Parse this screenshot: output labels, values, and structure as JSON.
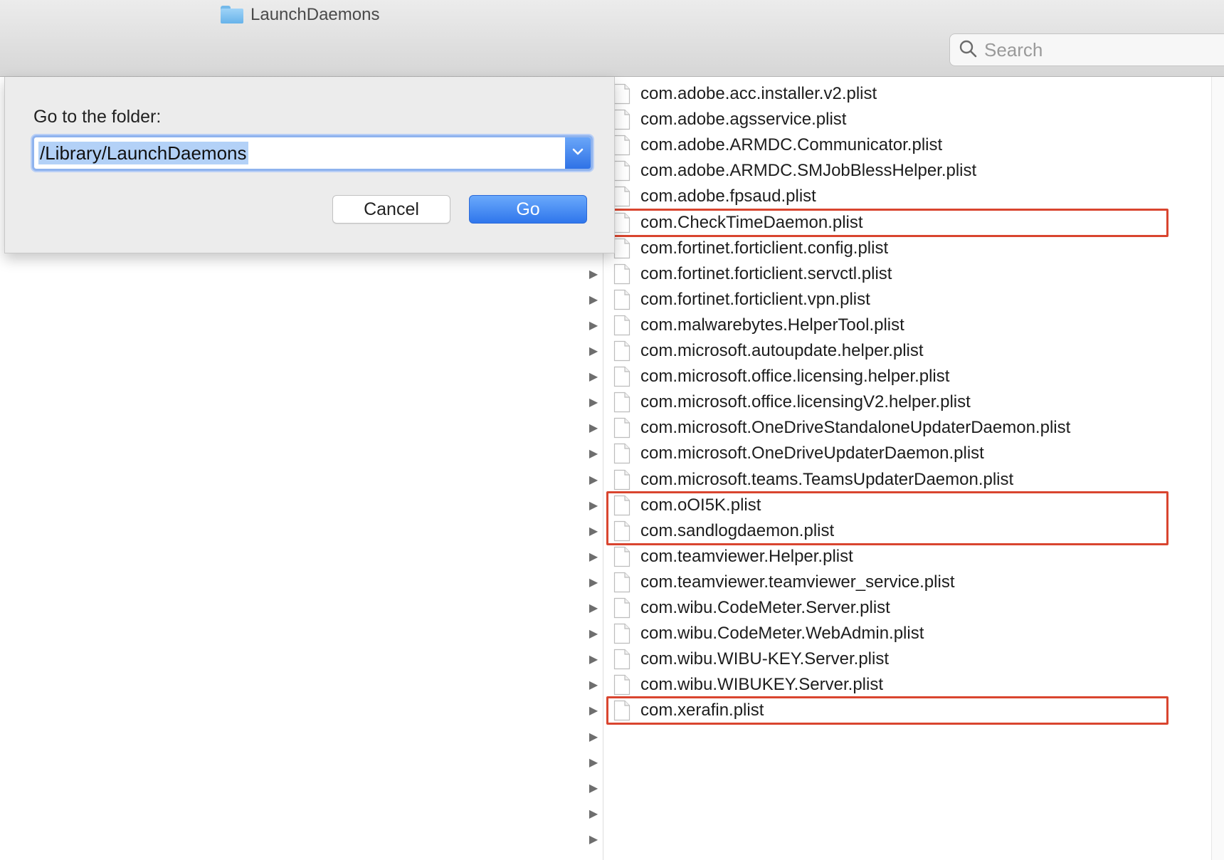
{
  "window": {
    "title": "LaunchDaemons",
    "folder_icon": "folder-icon"
  },
  "search": {
    "placeholder": "Search",
    "icon": "search-icon"
  },
  "goto_dialog": {
    "label": "Go to the folder:",
    "path_value": "/Library/LaunchDaemons",
    "cancel_label": "Cancel",
    "go_label": "Go",
    "accent_color": "#3478f6"
  },
  "files": [
    {
      "name": "com.adobe.acc.installer.v2.plist",
      "highlighted": false
    },
    {
      "name": "com.adobe.agsservice.plist",
      "highlighted": false
    },
    {
      "name": "com.adobe.ARMDC.Communicator.plist",
      "highlighted": false
    },
    {
      "name": "com.adobe.ARMDC.SMJobBlessHelper.plist",
      "highlighted": false
    },
    {
      "name": "com.adobe.fpsaud.plist",
      "highlighted": false
    },
    {
      "name": "com.CheckTimeDaemon.plist",
      "highlighted": true
    },
    {
      "name": "com.fortinet.forticlient.config.plist",
      "highlighted": false
    },
    {
      "name": "com.fortinet.forticlient.servctl.plist",
      "highlighted": false
    },
    {
      "name": "com.fortinet.forticlient.vpn.plist",
      "highlighted": false
    },
    {
      "name": "com.malwarebytes.HelperTool.plist",
      "highlighted": false
    },
    {
      "name": "com.microsoft.autoupdate.helper.plist",
      "highlighted": false
    },
    {
      "name": "com.microsoft.office.licensing.helper.plist",
      "highlighted": false
    },
    {
      "name": "com.microsoft.office.licensingV2.helper.plist",
      "highlighted": false
    },
    {
      "name": "com.microsoft.OneDriveStandaloneUpdaterDaemon.plist",
      "highlighted": false
    },
    {
      "name": "com.microsoft.OneDriveUpdaterDaemon.plist",
      "highlighted": false
    },
    {
      "name": "com.microsoft.teams.TeamsUpdaterDaemon.plist",
      "highlighted": false
    },
    {
      "name": "com.oOI5K.plist",
      "highlighted": true
    },
    {
      "name": "com.sandlogdaemon.plist",
      "highlighted": true
    },
    {
      "name": "com.teamviewer.Helper.plist",
      "highlighted": false
    },
    {
      "name": "com.teamviewer.teamviewer_service.plist",
      "highlighted": false
    },
    {
      "name": "com.wibu.CodeMeter.Server.plist",
      "highlighted": false
    },
    {
      "name": "com.wibu.CodeMeter.WebAdmin.plist",
      "highlighted": false
    },
    {
      "name": "com.wibu.WIBU-KEY.Server.plist",
      "highlighted": false
    },
    {
      "name": "com.wibu.WIBUKEY.Server.plist",
      "highlighted": false
    },
    {
      "name": "com.xerafin.plist",
      "highlighted": true
    }
  ],
  "highlight_color": "#d9452f",
  "disclosure_icon": "disclosure-triangle-icon",
  "file_icon": "document-icon"
}
